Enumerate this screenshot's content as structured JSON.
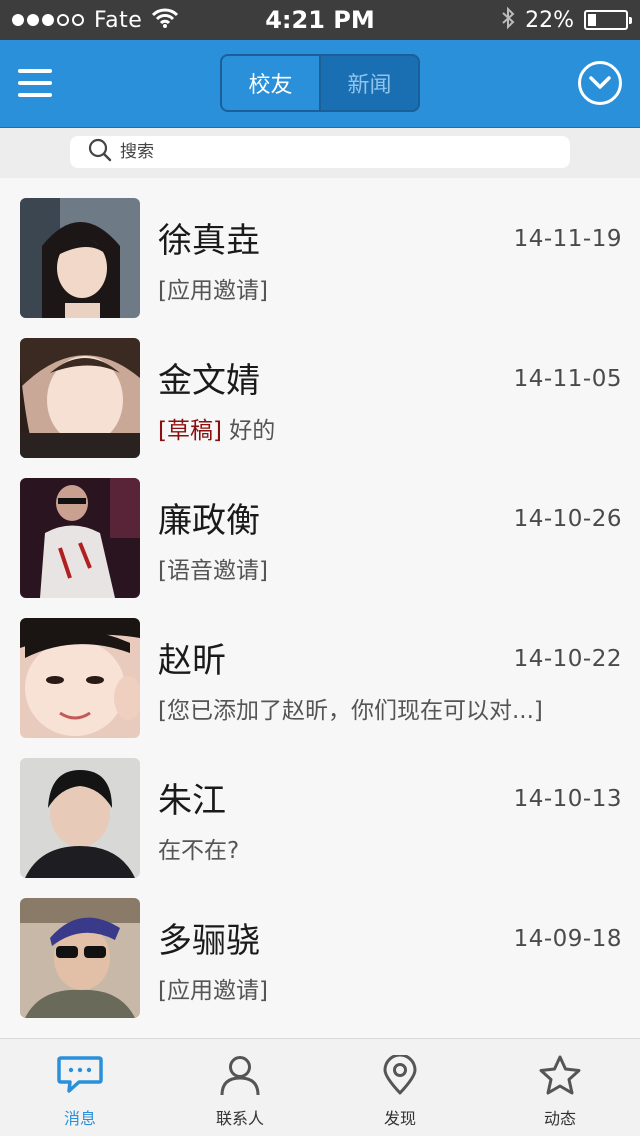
{
  "status_bar": {
    "carrier": "Fate",
    "time": "4:21 PM",
    "battery_percent": "22%",
    "battery_level": 0.22,
    "signal_bars_filled": 3,
    "signal_bars_total": 5,
    "wifi_icon": "wifi-icon",
    "bluetooth_icon": "bluetooth-icon"
  },
  "nav": {
    "menu_icon": "hamburger-menu-icon",
    "tabs": [
      {
        "label": "校友",
        "active": true
      },
      {
        "label": "新闻",
        "active": false
      }
    ],
    "dropdown_icon": "chevron-down-circle-icon"
  },
  "search": {
    "placeholder": "搜索",
    "value": ""
  },
  "conversations": [
    {
      "name": "徐真垚",
      "date": "14-11-19",
      "preview": "[应用邀请]",
      "draft_tag": ""
    },
    {
      "name": "金文婧",
      "date": "14-11-05",
      "preview": " 好的",
      "draft_tag": "[草稿]"
    },
    {
      "name": "廉政衡",
      "date": "14-10-26",
      "preview": "[语音邀请]",
      "draft_tag": ""
    },
    {
      "name": "赵昕",
      "date": "14-10-22",
      "preview": "[您已添加了赵昕，你们现在可以对...]",
      "draft_tag": ""
    },
    {
      "name": "朱江",
      "date": "14-10-13",
      "preview": "在不在?",
      "draft_tag": ""
    },
    {
      "name": "多骊骁",
      "date": "14-09-18",
      "preview": "[应用邀请]",
      "draft_tag": ""
    }
  ],
  "tabbar": {
    "items": [
      {
        "label": "消息",
        "icon": "chat-bubble-icon",
        "active": true
      },
      {
        "label": "联系人",
        "icon": "person-icon",
        "active": false
      },
      {
        "label": "发现",
        "icon": "location-pin-icon",
        "active": false
      },
      {
        "label": "动态",
        "icon": "star-icon",
        "active": false
      }
    ]
  },
  "colors": {
    "brand_blue": "#2a90da",
    "status_bar": "#3d3d3d",
    "draft_red": "#8a1010"
  }
}
